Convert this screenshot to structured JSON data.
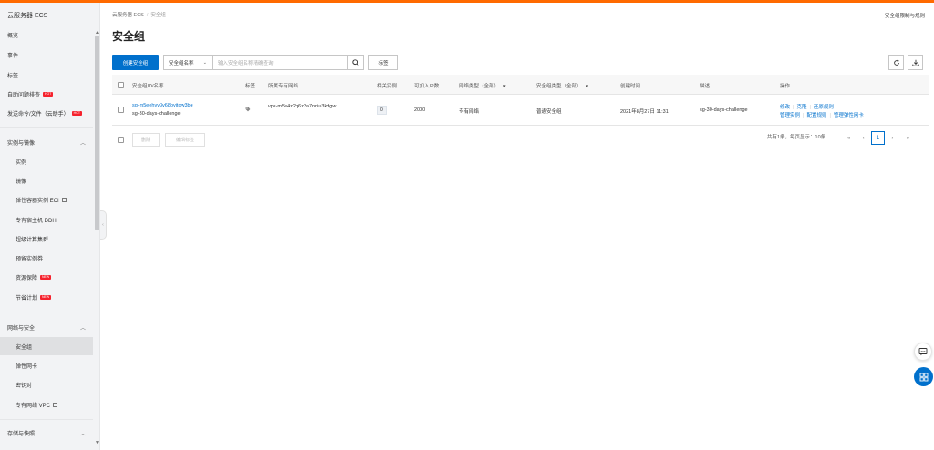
{
  "brand_color": "#ff6a00",
  "accent_color": "#0070cc",
  "sidebar": {
    "title": "云服务器 ECS",
    "items_top": [
      {
        "label": "概览"
      },
      {
        "label": "事件"
      },
      {
        "label": "标签"
      },
      {
        "label": "自助问题排查",
        "badge": "HOT"
      },
      {
        "label": "发送命令/文件（云助手）",
        "badge": "HOT"
      }
    ],
    "groups": [
      {
        "label": "实例与镜像",
        "items": [
          {
            "label": "实例"
          },
          {
            "label": "镜像"
          },
          {
            "label": "弹性容器实例 ECI",
            "external": true
          },
          {
            "label": "专有宿主机 DDH"
          },
          {
            "label": "超级计算集群"
          },
          {
            "label": "预留实例券"
          },
          {
            "label": "资源保障",
            "badge": "NEW"
          },
          {
            "label": "节省计划",
            "badge": "NEW"
          }
        ]
      },
      {
        "label": "网络与安全",
        "items": [
          {
            "label": "安全组",
            "active": true
          },
          {
            "label": "弹性网卡"
          },
          {
            "label": "密钥对"
          },
          {
            "label": "专有网络 VPC",
            "external": true
          }
        ]
      },
      {
        "label": "存储与快照",
        "items": []
      }
    ]
  },
  "breadcrumb": {
    "root": "云服务器 ECS",
    "separator": "/",
    "current": "安全组"
  },
  "top_link": "安全组限制与规则",
  "page_title": "安全组",
  "toolbar": {
    "create_label": "创建安全组",
    "filter_select": "安全组名称",
    "search_placeholder": "输入安全组名称精确查询",
    "tag_label": "标签",
    "refresh_icon": "refresh-icon",
    "download_icon": "download-icon"
  },
  "table": {
    "columns": [
      "安全组ID/名称",
      "标签",
      "所属专有网络",
      "相关实例",
      "可加入IP数",
      "网络类型（全部）",
      "安全组类型（全部）",
      "创建时间",
      "描述",
      "操作"
    ],
    "rows": [
      {
        "id": "sg-m5eehvy3v68byitow3be",
        "name": "sg-30-days-challenge",
        "vpc": "vpc-m5e4z2q6z3a7nniu3kdgw",
        "instances": "0",
        "ip_count": "2000",
        "network_type": "专有网络",
        "sg_type": "普通安全组",
        "created": "2021年8月27日 11:31",
        "description": "sg-30-days-challenge",
        "actions_row1": [
          "修改",
          "克隆",
          "还原规则"
        ],
        "actions_row2": [
          "管理实例",
          "配置规则",
          "管理弹性网卡"
        ]
      }
    ]
  },
  "bulk": {
    "delete_label": "删除",
    "edit_tag_label": "编辑标签"
  },
  "pager": {
    "summary": "共有1条，每页显示：10条",
    "first": "«",
    "prev": "‹",
    "current": "1",
    "next": "›",
    "last": "»"
  }
}
